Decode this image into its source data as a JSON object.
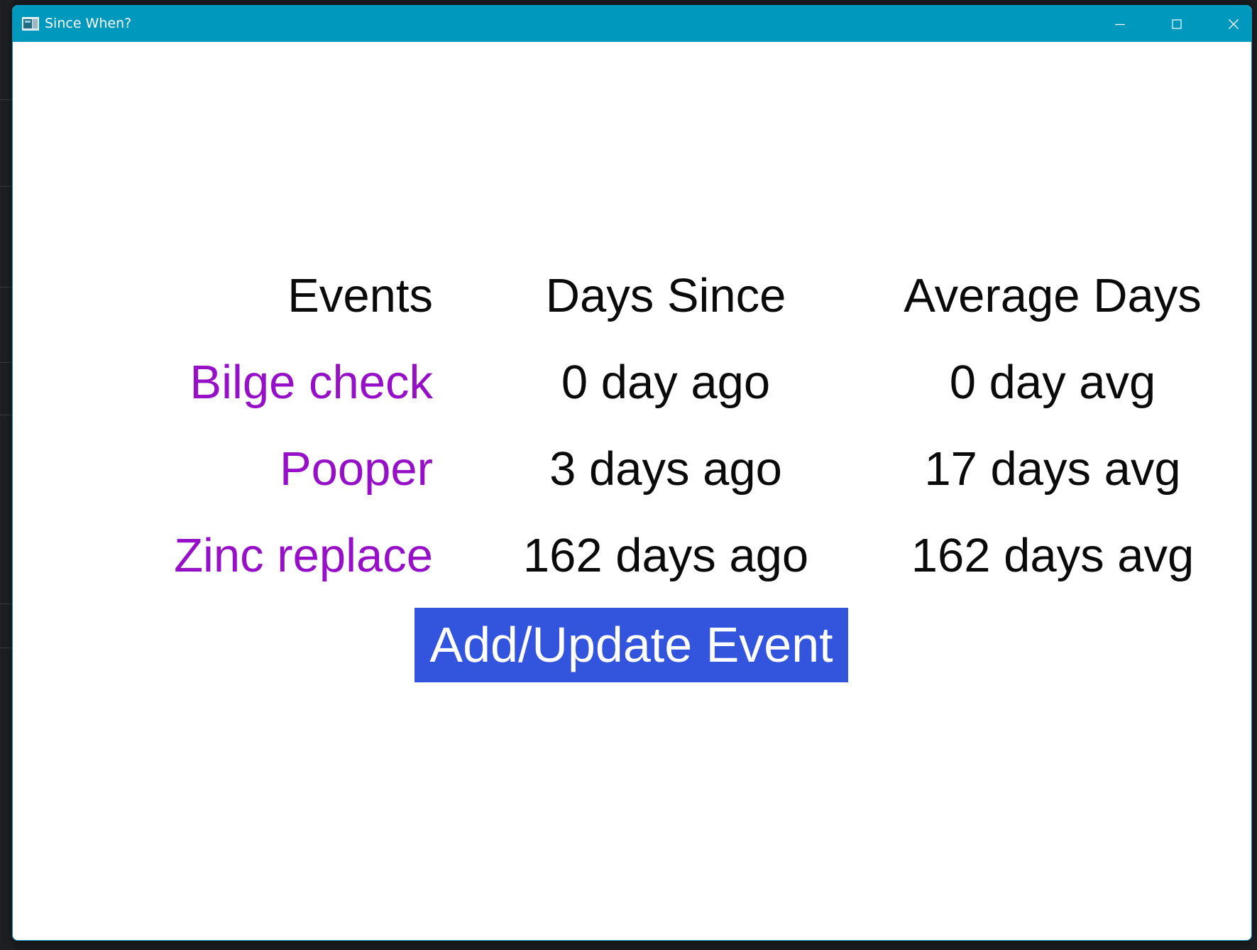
{
  "window": {
    "title": "Since When?",
    "accent_color": "#0098bd"
  },
  "titlebar": {
    "app_icon": "window-app-icon",
    "minimize_icon": "minimize-icon",
    "maximize_icon": "maximize-icon",
    "close_icon": "close-icon"
  },
  "table": {
    "headers": [
      "Events",
      "Days Since",
      "Average Days"
    ],
    "header_color": "#0a0a0a",
    "event_color": "#9510c6",
    "rows": [
      {
        "event": "Bilge check",
        "days_since": "0 day ago",
        "average": "0 day avg"
      },
      {
        "event": "Pooper",
        "days_since": "3 days ago",
        "average": "17 days avg"
      },
      {
        "event": "Zinc replace",
        "days_since": "162 days ago",
        "average": "162 days avg"
      }
    ]
  },
  "actions": {
    "add_update_label": "Add/Update Event",
    "button_color": "#3355dd"
  }
}
